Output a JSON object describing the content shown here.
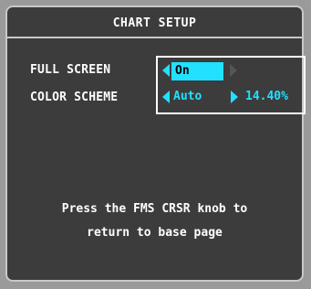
{
  "window": {
    "title": "CHART SETUP"
  },
  "settings": {
    "full_screen": {
      "label": "FULL SCREEN",
      "value": "On"
    },
    "color_scheme": {
      "label": "COLOR SCHEME",
      "value": "Auto",
      "percent": "14.40%"
    }
  },
  "message": {
    "line1": "Press the FMS CRSR knob to",
    "line2": "return to base page"
  },
  "colors": {
    "accent": "#22e0ff",
    "panel": "#3c3c3c",
    "text": "#ffffff"
  },
  "icons": {
    "left_arrow": "triangle-left-icon",
    "right_arrow": "triangle-right-icon"
  }
}
